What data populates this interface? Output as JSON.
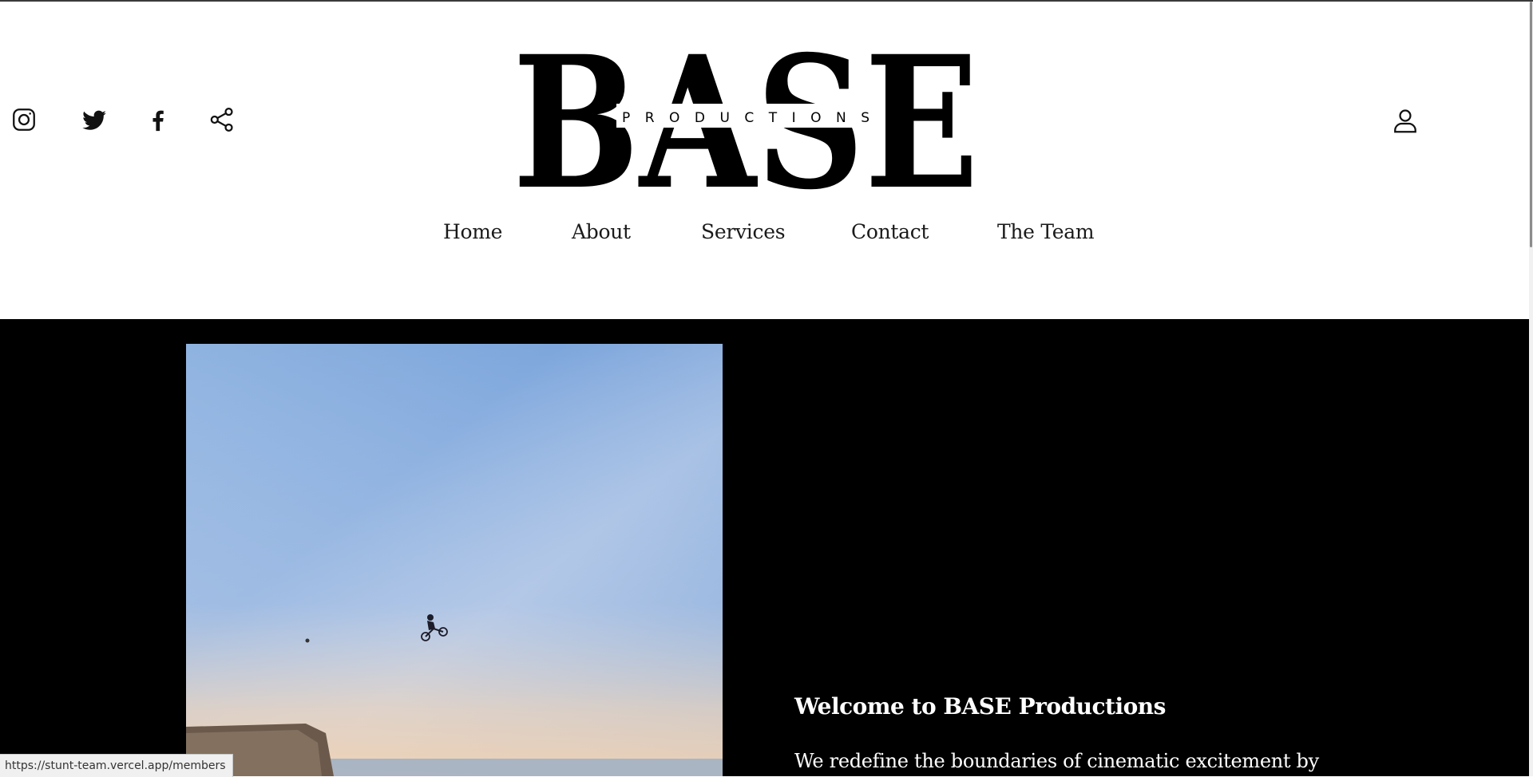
{
  "social": {
    "icons": [
      "instagram-icon",
      "twitter-icon",
      "facebook-icon",
      "share-icon"
    ]
  },
  "logo": {
    "wordmark": "BASE",
    "tagline": "PRODUCTIONS"
  },
  "account": {
    "icon": "user-icon"
  },
  "nav": {
    "items": [
      "Home",
      "About",
      "Services",
      "Contact",
      "The Team"
    ]
  },
  "hero": {
    "welcome_heading": "Welcome to BASE Productions",
    "intro_text": "We redefine the boundaries of cinematic excitement by"
  },
  "status_bar": {
    "url": "https://stunt-team.vercel.app/members"
  },
  "colors": {
    "header_bg": "#ffffff",
    "hero_bg": "#000000",
    "text_dark": "#1a1a1a",
    "text_light": "#ffffff"
  }
}
